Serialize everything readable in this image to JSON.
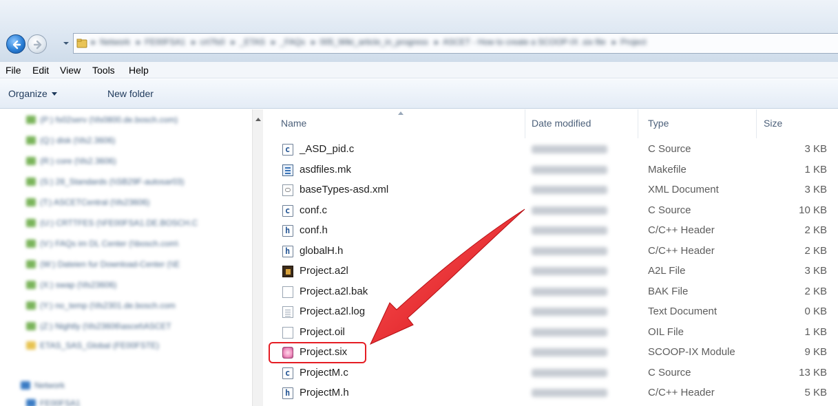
{
  "address_bar": {
    "crumbs": [
      "Network",
      "FE00FSA1",
      "crt7fs0",
      "_ETAS",
      "_FAQs",
      "005_Wiki_article_in_progress",
      "ASCET - How to create a SCOOP-IX .six file",
      "Project"
    ]
  },
  "menu": [
    "File",
    "Edit",
    "View",
    "Tools",
    "Help"
  ],
  "toolbar": {
    "organize_label": "Organize",
    "new_folder_label": "New folder"
  },
  "nav_pane": {
    "items": [
      "(P:) fs02serv (\\\\fs0800.de.bosch.com)",
      "(Q:) disk (\\\\fs2.3606)",
      "(R:) core (\\\\fs2.3606)",
      "(S:) 28_Standards (\\\\SB29F-autosar03)",
      "(T:) ASCETCentral (\\\\fs23606)",
      "(U:) CRTTFES (\\\\FE00FSA1.DE.BOSCH.C",
      "(V:) FAQs im DL Center (\\\\bosch.com\\",
      "(W:) Dateien fur Download-Center (\\\\E",
      "(X:) swap (\\\\fs23606)",
      "(Y:) no_temp (\\\\fs2301.de.bosch.com",
      "(Z:) Nightly (\\\\fs23606\\ascet\\ASCET",
      "ETAS_SAS_Global (FE00FSTE)",
      "Network",
      "FE00FSA1"
    ]
  },
  "columns": {
    "name": "Name",
    "date": "Date modified",
    "type": "Type",
    "size": "Size"
  },
  "files": [
    {
      "name": "_ASD_pid.c",
      "type": "C Source",
      "size": "3 KB",
      "icon": "c-source-icon"
    },
    {
      "name": "asdfiles.mk",
      "type": "Makefile",
      "size": "1 KB",
      "icon": "makefile-icon"
    },
    {
      "name": "baseTypes-asd.xml",
      "type": "XML Document",
      "size": "3 KB",
      "icon": "xml-document-icon"
    },
    {
      "name": "conf.c",
      "type": "C Source",
      "size": "10 KB",
      "icon": "c-source-icon"
    },
    {
      "name": "conf.h",
      "type": "C/C++ Header",
      "size": "2 KB",
      "icon": "header-file-icon"
    },
    {
      "name": "globalH.h",
      "type": "C/C++ Header",
      "size": "2 KB",
      "icon": "header-file-icon"
    },
    {
      "name": "Project.a2l",
      "type": "A2L File",
      "size": "3 KB",
      "icon": "a2l-file-icon"
    },
    {
      "name": "Project.a2l.bak",
      "type": "BAK File",
      "size": "2 KB",
      "icon": "blank-file-icon"
    },
    {
      "name": "Project.a2l.log",
      "type": "Text Document",
      "size": "0 KB",
      "icon": "text-document-icon"
    },
    {
      "name": "Project.oil",
      "type": "OIL File",
      "size": "1 KB",
      "icon": "blank-file-icon"
    },
    {
      "name": "Project.six",
      "type": "SCOOP-IX Module",
      "size": "9 KB",
      "icon": "scoop-ix-module-icon"
    },
    {
      "name": "ProjectM.c",
      "type": "C Source",
      "size": "13 KB",
      "icon": "c-source-icon"
    },
    {
      "name": "ProjectM.h",
      "type": "C/C++ Header",
      "size": "5 KB",
      "icon": "header-file-icon"
    }
  ],
  "annotation": {
    "highlighted_file": "Project.six",
    "highlight_color": "#e51c23"
  }
}
